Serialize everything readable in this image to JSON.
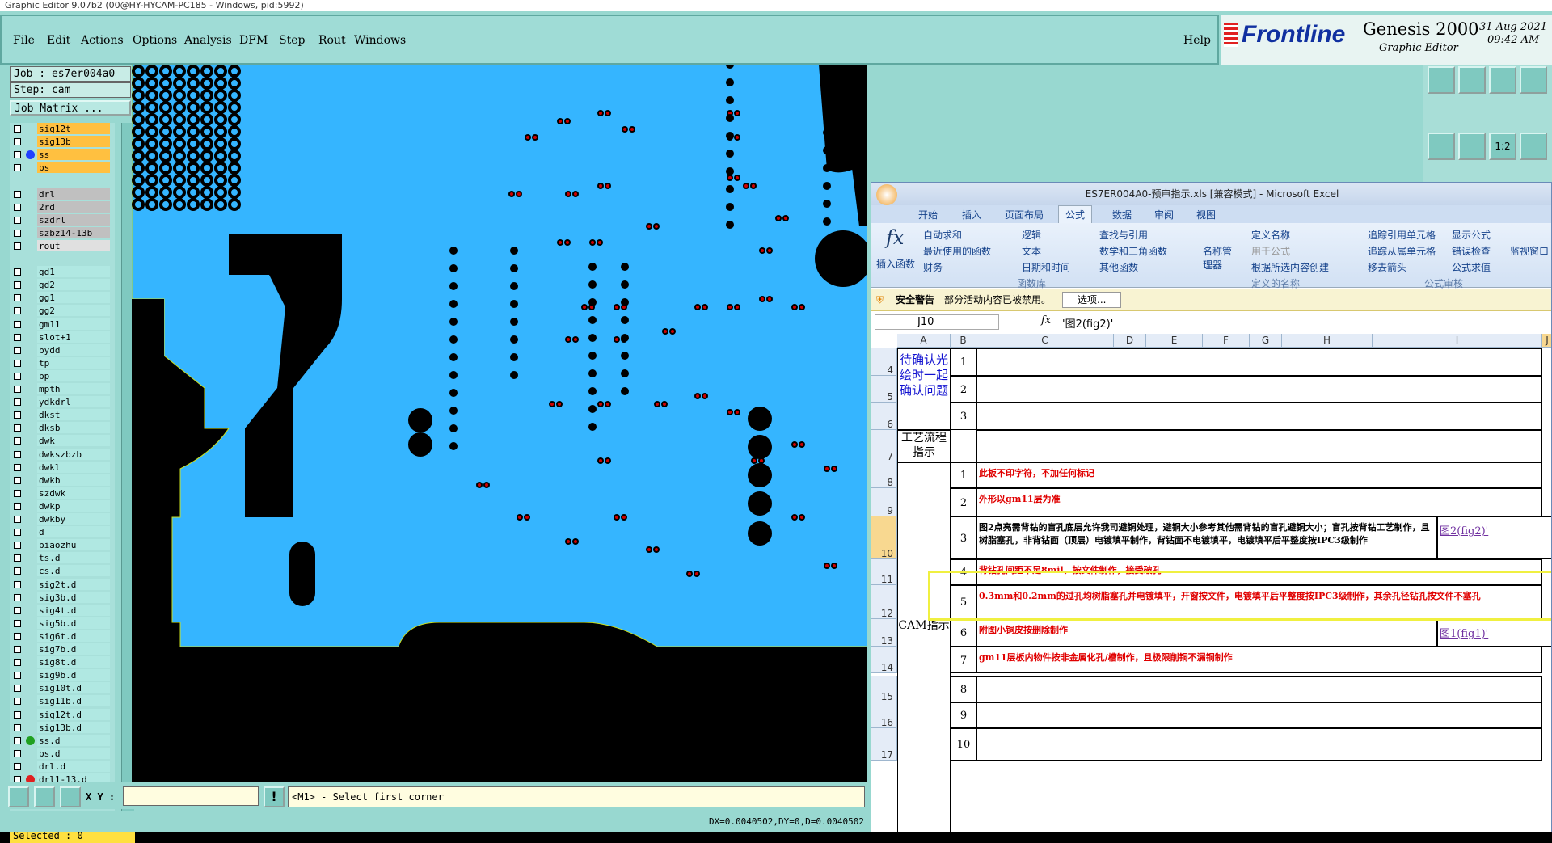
{
  "window": {
    "title": "Graphic Editor 9.07b2 (00@HY-HYCAM-PC185 - Windows, pid:5992)"
  },
  "menu": [
    "File",
    "Edit",
    "Actions",
    "Options",
    "Analysis",
    "DFM",
    "Step",
    "Rout",
    "Windows"
  ],
  "help": "Help",
  "brand": {
    "logo": "Frontline",
    "product": "Genesis 2000",
    "subtitle": "Graphic Editor",
    "date": "31 Aug 2021",
    "time": "09:42 AM"
  },
  "job": {
    "job_label": "Job : es7er004a0",
    "step_label": "Step: cam",
    "matrix_button": "Job Matrix ..."
  },
  "layers": [
    {
      "name": "sig12t",
      "color": "#ffc040",
      "mark": ""
    },
    {
      "name": "sig13b",
      "color": "#ffc040",
      "mark": ""
    },
    {
      "name": "ss",
      "color": "#ffc040",
      "mark": "#2040ff"
    },
    {
      "name": "bs",
      "color": "#ffc040",
      "mark": ""
    },
    {
      "name": "",
      "color": "",
      "mark": ""
    },
    {
      "name": "drl",
      "color": "#c0c0c0",
      "mark": ""
    },
    {
      "name": "2rd",
      "color": "#c0c0c0",
      "mark": ""
    },
    {
      "name": "szdrl",
      "color": "#c0c0c0",
      "mark": ""
    },
    {
      "name": "szbz14-13b",
      "color": "#c0c0c0",
      "mark": ""
    },
    {
      "name": "rout",
      "color": "#e0e0e0",
      "mark": ""
    },
    {
      "name": "",
      "color": "",
      "mark": ""
    },
    {
      "name": "gd1",
      "color": "#b0e8e2",
      "mark": ""
    },
    {
      "name": "gd2",
      "color": "#b0e8e2",
      "mark": ""
    },
    {
      "name": "gg1",
      "color": "#b0e8e2",
      "mark": ""
    },
    {
      "name": "gg2",
      "color": "#b0e8e2",
      "mark": ""
    },
    {
      "name": "gm11",
      "color": "#b0e8e2",
      "mark": ""
    },
    {
      "name": "slot+1",
      "color": "#b0e8e2",
      "mark": ""
    },
    {
      "name": "bydd",
      "color": "#b0e8e2",
      "mark": ""
    },
    {
      "name": "tp",
      "color": "#b0e8e2",
      "mark": ""
    },
    {
      "name": "bp",
      "color": "#b0e8e2",
      "mark": ""
    },
    {
      "name": "mpth",
      "color": "#b0e8e2",
      "mark": ""
    },
    {
      "name": "ydkdrl",
      "color": "#b0e8e2",
      "mark": ""
    },
    {
      "name": "dkst",
      "color": "#b0e8e2",
      "mark": ""
    },
    {
      "name": "dksb",
      "color": "#b0e8e2",
      "mark": ""
    },
    {
      "name": "dwk",
      "color": "#b0e8e2",
      "mark": ""
    },
    {
      "name": "dwkszbzb",
      "color": "#b0e8e2",
      "mark": ""
    },
    {
      "name": "dwkl",
      "color": "#b0e8e2",
      "mark": ""
    },
    {
      "name": "dwkb",
      "color": "#b0e8e2",
      "mark": ""
    },
    {
      "name": "szdwk",
      "color": "#b0e8e2",
      "mark": ""
    },
    {
      "name": "dwkp",
      "color": "#b0e8e2",
      "mark": ""
    },
    {
      "name": "dwkby",
      "color": "#b0e8e2",
      "mark": ""
    },
    {
      "name": "d",
      "color": "#b0e8e2",
      "mark": ""
    },
    {
      "name": "biaozhu",
      "color": "#b0e8e2",
      "mark": ""
    },
    {
      "name": "ts.d",
      "color": "#b0e8e2",
      "mark": ""
    },
    {
      "name": "cs.d",
      "color": "#b0e8e2",
      "mark": ""
    },
    {
      "name": "sig2t.d",
      "color": "#b0e8e2",
      "mark": ""
    },
    {
      "name": "sig3b.d",
      "color": "#b0e8e2",
      "mark": ""
    },
    {
      "name": "sig4t.d",
      "color": "#b0e8e2",
      "mark": ""
    },
    {
      "name": "sig5b.d",
      "color": "#b0e8e2",
      "mark": ""
    },
    {
      "name": "sig6t.d",
      "color": "#b0e8e2",
      "mark": ""
    },
    {
      "name": "sig7b.d",
      "color": "#b0e8e2",
      "mark": ""
    },
    {
      "name": "sig8t.d",
      "color": "#b0e8e2",
      "mark": ""
    },
    {
      "name": "sig9b.d",
      "color": "#b0e8e2",
      "mark": ""
    },
    {
      "name": "sig10t.d",
      "color": "#b0e8e2",
      "mark": ""
    },
    {
      "name": "sig11b.d",
      "color": "#b0e8e2",
      "mark": ""
    },
    {
      "name": "sig12t.d",
      "color": "#b0e8e2",
      "mark": ""
    },
    {
      "name": "sig13b.d",
      "color": "#b0e8e2",
      "mark": ""
    },
    {
      "name": "ss.d",
      "color": "#b0e8e2",
      "mark": "#20a020"
    },
    {
      "name": "bs.d",
      "color": "#b0e8e2",
      "mark": ""
    },
    {
      "name": "drl.d",
      "color": "#b0e8e2",
      "mark": ""
    },
    {
      "name": "drl1-13.d",
      "color": "#b0e8e2",
      "mark": "#e02020"
    }
  ],
  "selected": "Selected : 0",
  "status": {
    "xy_label": "X Y :",
    "xy_value": "",
    "prompt": "<M1> - Select first corner",
    "measure": "DX=0.0040502,DY=0,D=0.0040502"
  },
  "excel": {
    "title": "ES7ER004A0-预审指示.xls [兼容模式] - Microsoft Excel",
    "tabs": [
      "开始",
      "插入",
      "页面布局",
      "公式",
      "数据",
      "审阅",
      "视图"
    ],
    "active_tab": "公式",
    "ribbon": {
      "insert_fn": "插入函数",
      "lib": [
        "自动求和",
        "最近使用的函数",
        "财务",
        "逻辑",
        "文本",
        "日期和时间",
        "查找与引用",
        "数学和三角函数",
        "其他函数"
      ],
      "names": [
        "名称管理器",
        "定义名称",
        "用于公式",
        "根据所选内容创建"
      ],
      "audit": [
        "追踪引用单元格",
        "追踪从属单元格",
        "移去箭头",
        "显示公式",
        "错误检查",
        "公式求值",
        "监视窗口"
      ],
      "groups": [
        "函数库",
        "定义的名称",
        "公式审核"
      ]
    },
    "security": {
      "label": "安全警告",
      "message": "部分活动内容已被禁用。",
      "button": "选项..."
    },
    "name_box": "J10",
    "formula": "'图2(fig2)'",
    "columns": [
      "A",
      "B",
      "C",
      "D",
      "E",
      "F",
      "G",
      "H",
      "I",
      "J"
    ],
    "rows": [
      {
        "n": "4",
        "b": "1",
        "text": "",
        "link": ""
      },
      {
        "n": "5",
        "b": "2",
        "text": "",
        "link": ""
      },
      {
        "n": "6",
        "b": "3",
        "text": "",
        "link": ""
      },
      {
        "n": "7",
        "b": "",
        "text": "",
        "link": ""
      },
      {
        "n": "8",
        "b": "1",
        "text": "此板不印字符，不加任何标记",
        "link": ""
      },
      {
        "n": "9",
        "b": "2",
        "text": "外形以gm11层为准",
        "link": ""
      },
      {
        "n": "10",
        "b": "3",
        "text": "图2点亮需背钻的盲孔底层允许我司避铜处理，避铜大小参考其他需背钻的盲孔避铜大小；盲孔按背钻工艺制作，且树脂塞孔，非背钻面（顶层）电镀填平制作，背钻面不电镀填平，电镀填平后平整度按IPC3级制作",
        "link": "图2(fig2)'"
      },
      {
        "n": "11",
        "b": "4",
        "text": "背钻孔间距不足8mil，按文件制作，接受破孔",
        "link": ""
      },
      {
        "n": "12",
        "b": "5",
        "text": "0.3mm和0.2mm的过孔均树脂塞孔并电镀填平，开窗按文件，电镀填平后平整度按IPC3级制作，其余孔径钻孔按文件不塞孔",
        "link": ""
      },
      {
        "n": "13",
        "b": "6",
        "text": "附图小铜皮按删除制作",
        "link": "图1(fig1)'"
      },
      {
        "n": "14",
        "b": "7",
        "text": "gm11层板内物件按非金属化孔/槽制作，且极限削铜不漏铜制作",
        "link": ""
      },
      {
        "n": "15",
        "b": "8",
        "text": "",
        "link": ""
      },
      {
        "n": "16",
        "b": "9",
        "text": "",
        "link": ""
      },
      {
        "n": "17",
        "b": "10",
        "text": "",
        "link": ""
      }
    ],
    "a_labels": {
      "confirm": "待确认光绘时一起确认问题",
      "process": "工艺流程指示",
      "cam": "CAM指示"
    }
  },
  "colors": {
    "board": "#35b5ff",
    "copper": "#000000",
    "pad": "#e00000",
    "panel": "#98d8d0",
    "highlight": "#f0f060"
  }
}
